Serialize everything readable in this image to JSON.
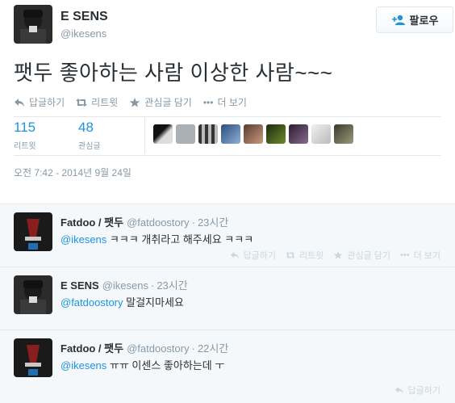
{
  "main_tweet": {
    "name": "E SENS",
    "handle": "@ikesens",
    "follow_label": "팔로우",
    "text": "팻두 좋아하는 사람 이상한 사람~~~",
    "actions": {
      "reply": "답글하기",
      "retweet": "리트윗",
      "favorite": "관심글 담기",
      "more": "더 보기",
      "more_icon": "•••"
    },
    "stats": {
      "retweets_count": "115",
      "retweets_label": "리트윗",
      "favorites_count": "48",
      "favorites_label": "관심글"
    },
    "timestamp": "오전 7:42 - 2014년 9월 24일"
  },
  "replies": [
    {
      "name": "Fatdoo / 팻두",
      "handle": "@fatdoostory",
      "dot": "·",
      "time": "23시간",
      "mention": "@ikesens",
      "text": " ㅋㅋㅋ 개취라고 해주세요 ㅋㅋㅋ"
    },
    {
      "name": "E SENS",
      "handle": "@ikesens",
      "dot": "·",
      "time": "23시간",
      "mention": "@fatdoostory",
      "text": " 말걸지마세요"
    },
    {
      "name": "Fatdoo / 팻두",
      "handle": "@fatdoostory",
      "dot": "·",
      "time": "22시간",
      "mention": "@ikesens",
      "text": " ㅠㅠ 이센스 좋아하는데 ㅜ"
    }
  ],
  "reply_actions": {
    "reply": "답글하기",
    "retweet": "리트윗",
    "favorite": "관심글 담기",
    "more": "더 보기",
    "more_icon": "•••"
  },
  "colors": {
    "link": "#1b95e0",
    "muted": "#8899a6",
    "reply_bg": "#f5f8fa"
  }
}
